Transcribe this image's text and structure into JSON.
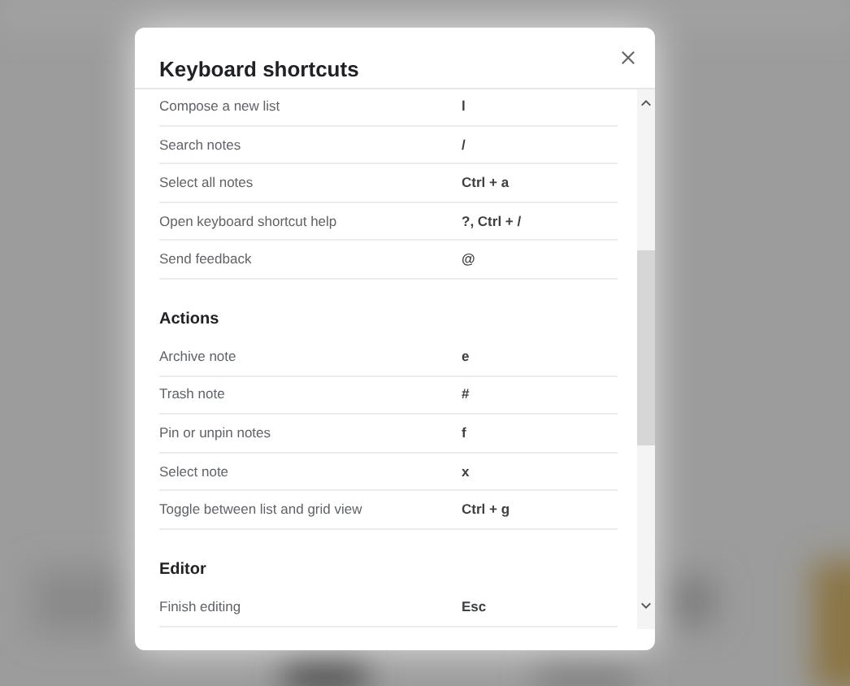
{
  "dialog": {
    "title": "Keyboard shortcuts",
    "sections": [
      {
        "rows": [
          {
            "action": "Compose a new list",
            "keys": "l"
          },
          {
            "action": "Search notes",
            "keys": "/"
          },
          {
            "action": "Select all notes",
            "keys": "Ctrl + a"
          },
          {
            "action": "Open keyboard shortcut help",
            "keys": "?, Ctrl + /"
          },
          {
            "action": "Send feedback",
            "keys": "@"
          }
        ]
      },
      {
        "heading": "Actions",
        "rows": [
          {
            "action": "Archive note",
            "keys": "e"
          },
          {
            "action": "Trash note",
            "keys": "#"
          },
          {
            "action": "Pin or unpin notes",
            "keys": "f"
          },
          {
            "action": "Select note",
            "keys": "x"
          },
          {
            "action": "Toggle between list and grid view",
            "keys": "Ctrl + g"
          }
        ]
      },
      {
        "heading": "Editor",
        "rows": [
          {
            "action": "Finish editing",
            "keys": "Esc"
          }
        ]
      }
    ]
  }
}
